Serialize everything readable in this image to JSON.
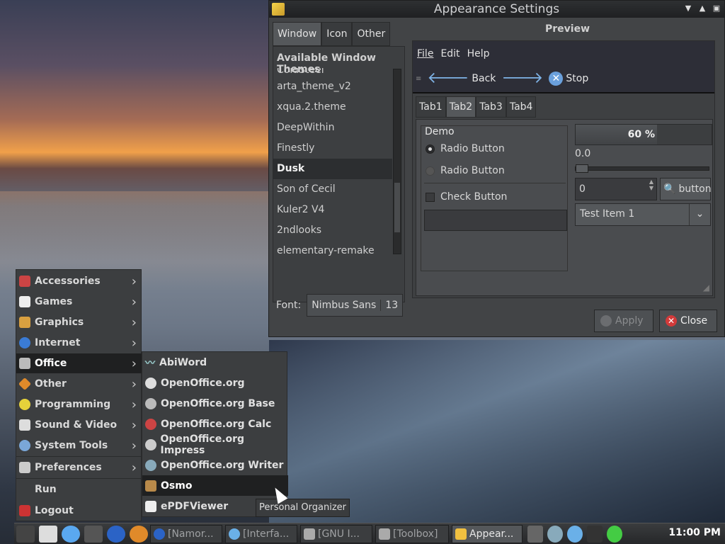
{
  "window": {
    "title": "Appearance Settings",
    "tabs": [
      "Window",
      "Icon",
      "Other"
    ],
    "themes_header": "Available Window Themes",
    "themes": [
      "ColdSteel",
      "arta_theme_v2",
      "xqua.2.theme",
      "DeepWithin",
      "Finestly",
      "Dusk",
      "Son of Cecil",
      "Kuler2 V4",
      "2ndlooks",
      "elementary-remake"
    ],
    "selected_theme": "Dusk",
    "font_label": "Font:",
    "font_name": "Nimbus Sans",
    "font_size": "13",
    "preview_label": "Preview",
    "apply_label": "Apply",
    "close_label": "Close"
  },
  "preview": {
    "menu": [
      "File",
      "Edit",
      "Help"
    ],
    "back_label": "Back",
    "stop_label": "Stop",
    "tabs": [
      "Tab1",
      "Tab2",
      "Tab3",
      "Tab4"
    ],
    "demo_label": "Demo",
    "radio1": "Radio Button",
    "radio2": "Radio Button",
    "check": "Check Button",
    "progress_text": "60 %",
    "progress_fraction": 0.6,
    "slider_value": "0.0",
    "spin_value": "0",
    "search_button": "button",
    "combo_value": "Test Item 1"
  },
  "start_menu": {
    "items": [
      {
        "label": "Accessories",
        "icon": "accessories-icon",
        "submenu": true
      },
      {
        "label": "Games",
        "icon": "games-icon",
        "submenu": true
      },
      {
        "label": "Graphics",
        "icon": "graphics-icon",
        "submenu": true
      },
      {
        "label": "Internet",
        "icon": "internet-icon",
        "submenu": true
      },
      {
        "label": "Office",
        "icon": "office-icon",
        "submenu": true
      },
      {
        "label": "Other",
        "icon": "other-icon",
        "submenu": true
      },
      {
        "label": "Programming",
        "icon": "programming-icon",
        "submenu": true
      },
      {
        "label": "Sound & Video",
        "icon": "sound-video-icon",
        "submenu": true
      },
      {
        "label": "System Tools",
        "icon": "system-tools-icon",
        "submenu": true
      },
      {
        "label": "Preferences",
        "icon": "preferences-icon",
        "submenu": true
      },
      {
        "label": "Run",
        "icon": "",
        "submenu": false
      },
      {
        "label": "Logout",
        "icon": "logout-icon",
        "submenu": false
      }
    ],
    "selected": "Office"
  },
  "office_menu": {
    "items": [
      "AbiWord",
      "OpenOffice.org",
      "OpenOffice.org Base",
      "OpenOffice.org Calc",
      "OpenOffice.org Impress",
      "OpenOffice.org Writer",
      "Osmo",
      "ePDFViewer"
    ],
    "selected": "Osmo",
    "tooltip": "Personal Organizer"
  },
  "taskbar": {
    "tasks": [
      "[Namor...",
      "[Interfa...",
      "[GNU I...",
      "[Toolbox]",
      "Appear..."
    ],
    "active_task": "Appear...",
    "clock": "11:00 PM"
  }
}
